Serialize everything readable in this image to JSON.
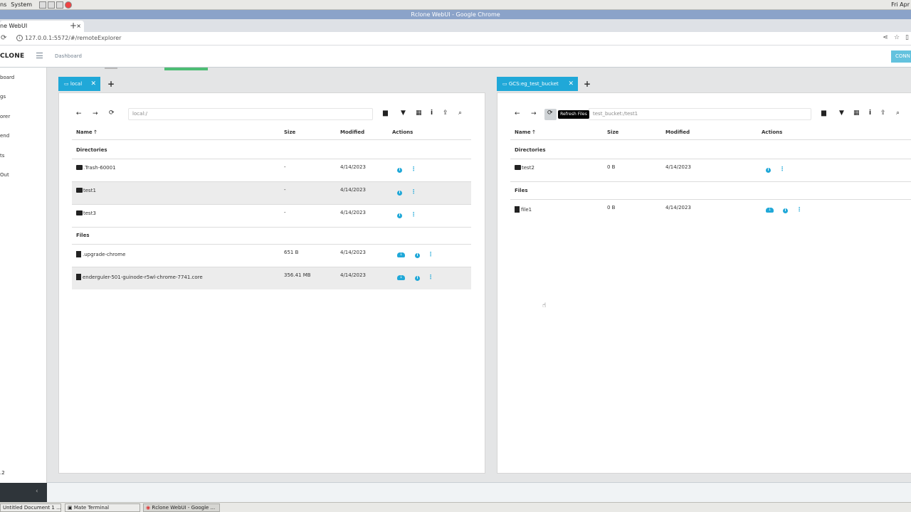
{
  "system_panel": {
    "menu1": "ns",
    "menu2": "System",
    "clock": "Fri Apr"
  },
  "window": {
    "title": "Rclone WebUI - Google Chrome"
  },
  "browser": {
    "tab_title": "ne WebUI",
    "tab_close": "×",
    "new_tab": "+",
    "url": "127.0.0.1:5572/#/remoteExplorer"
  },
  "app": {
    "brand": "CLONE",
    "breadcrumb": "Dashboard",
    "connect_label": "CONN"
  },
  "sidebar": {
    "items": [
      {
        "label": "board"
      },
      {
        "label": "gs"
      },
      {
        "label": "orer"
      },
      {
        "label": "end"
      },
      {
        "label": "ts"
      },
      {
        "label": "Out"
      }
    ],
    "version": ".2",
    "collapse_icon": "‹"
  },
  "table_headers": {
    "name": "Name",
    "size": "Size",
    "modified": "Modified",
    "actions": "Actions"
  },
  "sections": {
    "directories": "Directories",
    "files": "Files"
  },
  "left_panel": {
    "tab_label": "local",
    "path": "local:/",
    "directories": [
      {
        "name": ".Trash-60001",
        "size": "-",
        "modified": "4/14/2023"
      },
      {
        "name": "test1",
        "size": "-",
        "modified": "4/14/2023"
      },
      {
        "name": "test3",
        "size": "-",
        "modified": "4/14/2023"
      }
    ],
    "files": [
      {
        "name": ".upgrade-chrome",
        "size": "651 B",
        "modified": "4/14/2023"
      },
      {
        "name": "enderguler-501-guinode-r5wl-chrome-7741.core",
        "size": "356.41 MB",
        "modified": "4/14/2023"
      }
    ]
  },
  "right_panel": {
    "tab_label": "GCS:eg_test_bucket",
    "path": "test_bucket:/test1",
    "tooltip": "Refresh Files",
    "directories": [
      {
        "name": "test2",
        "size": "0 B",
        "modified": "4/14/2023"
      }
    ],
    "files": [
      {
        "name": "file1",
        "size": "0 B",
        "modified": "4/14/2023"
      }
    ]
  },
  "taskbar": [
    {
      "label": "Untitled Document 1 ..."
    },
    {
      "label": "Mate Terminal"
    },
    {
      "label": "Rclone WebUI - Google ..."
    }
  ]
}
